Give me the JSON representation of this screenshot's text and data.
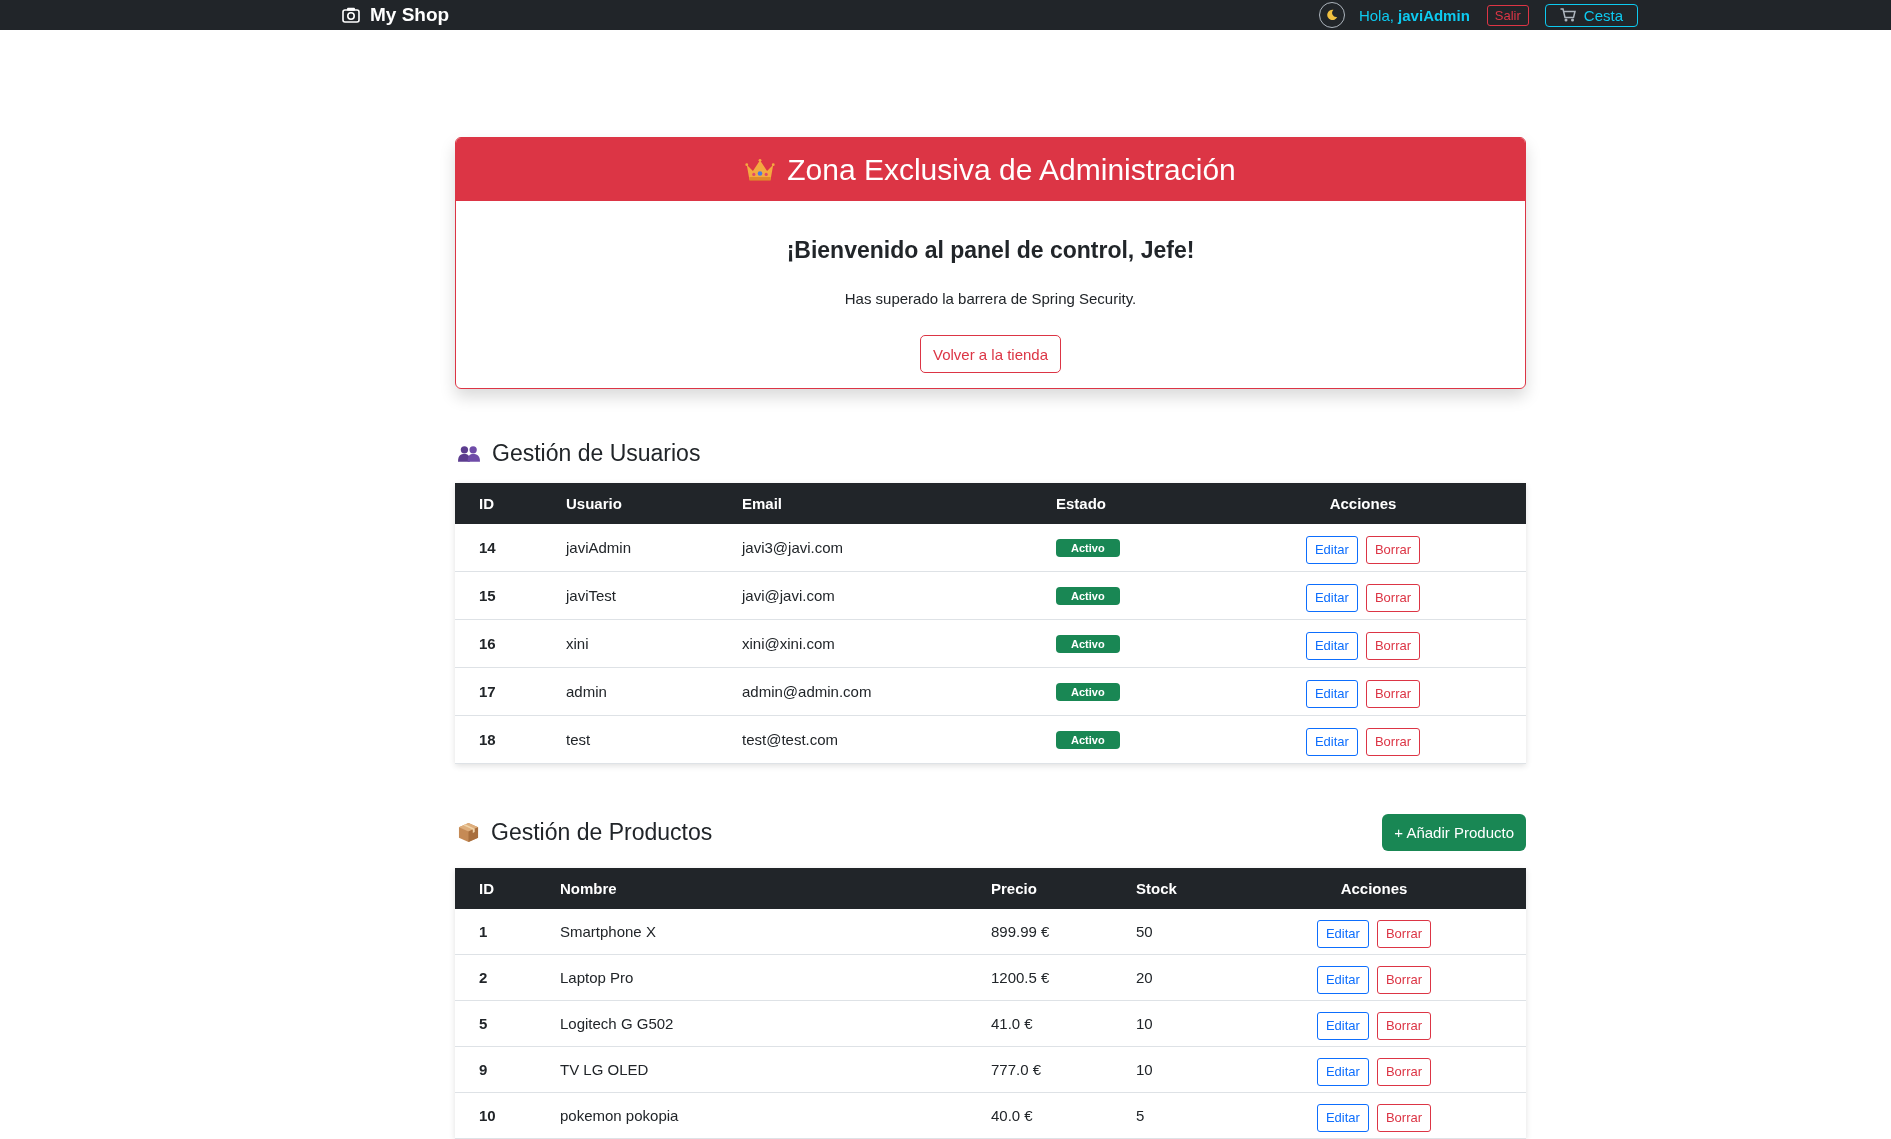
{
  "navbar": {
    "brand": "My Shop",
    "greeting": "Hola, **javiAdmin**",
    "logout_button": "Salir",
    "cart_button": "Cesta"
  },
  "admin_card": {
    "title": "Zona Exclusiva de Administración",
    "welcome": "¡Bienvenido al panel de control, Jefe!",
    "message": "Has superado la barrera de Spring Security.",
    "back_button": "Volver a la tienda"
  },
  "users_section": {
    "title": "Gestión de Usuarios",
    "columns": [
      "ID",
      "Usuario",
      "Email",
      "Estado",
      "Acciones"
    ],
    "rows": [
      {
        "id": "14",
        "username": "javiAdmin",
        "email": "javi3@javi.com",
        "status": "Activo",
        "edit": "Editar",
        "delete": "Borrar"
      },
      {
        "id": "15",
        "username": "javiTest",
        "email": "javi@javi.com",
        "status": "Activo",
        "edit": "Editar",
        "delete": "Borrar"
      },
      {
        "id": "16",
        "username": "xini",
        "email": "xini@xini.com",
        "status": "Activo",
        "edit": "Editar",
        "delete": "Borrar"
      },
      {
        "id": "17",
        "username": "admin",
        "email": "admin@admin.com",
        "status": "Activo",
        "edit": "Editar",
        "delete": "Borrar"
      },
      {
        "id": "18",
        "username": "test",
        "email": "test@test.com",
        "status": "Activo",
        "edit": "Editar",
        "delete": "Borrar"
      }
    ]
  },
  "products_section": {
    "title": "Gestión de Productos",
    "add_button": "+ Añadir Producto",
    "columns": [
      "ID",
      "Nombre",
      "Precio",
      "Stock",
      "Acciones"
    ],
    "rows": [
      {
        "id": "1",
        "name": "Smartphone X",
        "price": "899.99 €",
        "stock": "50",
        "edit": "Editar",
        "delete": "Borrar"
      },
      {
        "id": "2",
        "name": "Laptop Pro",
        "price": "1200.5 €",
        "stock": "20",
        "edit": "Editar",
        "delete": "Borrar"
      },
      {
        "id": "5",
        "name": "Logitech G G502",
        "price": "41.0 €",
        "stock": "10",
        "edit": "Editar",
        "delete": "Borrar"
      },
      {
        "id": "9",
        "name": "TV LG OLED",
        "price": "777.0 €",
        "stock": "10",
        "edit": "Editar",
        "delete": "Borrar"
      },
      {
        "id": "10",
        "name": "pokemon pokopia",
        "price": "40.0 €",
        "stock": "5",
        "edit": "Editar",
        "delete": "Borrar"
      }
    ]
  }
}
